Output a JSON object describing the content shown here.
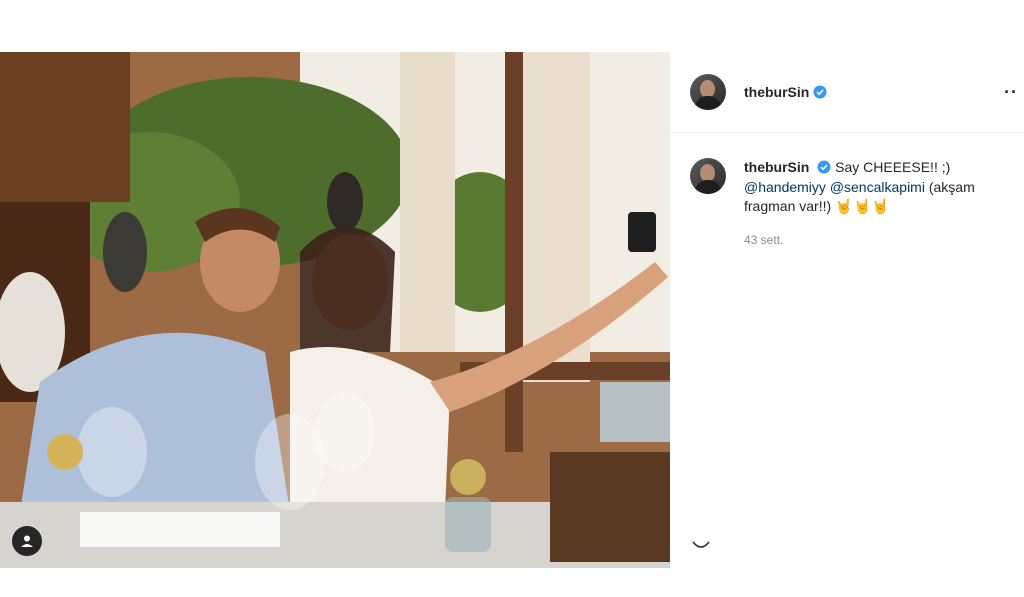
{
  "post": {
    "photo_alt": "Selfie photo at outdoor terrace restaurant",
    "tag_icon": "person-tag-icon"
  },
  "header": {
    "username": "theburSin",
    "verified_icon": "verified-badge-icon",
    "more_icon": "more-options-icon"
  },
  "caption": {
    "username": "theburSin",
    "text_1": "Say CHEEESE!! ;)",
    "mention_1": "@handemiyy",
    "mention_2": "@sencalkapimi",
    "text_2": "(akşam fragman var!!)",
    "emoji": "🤘🤘🤘",
    "time": "43 sett."
  }
}
